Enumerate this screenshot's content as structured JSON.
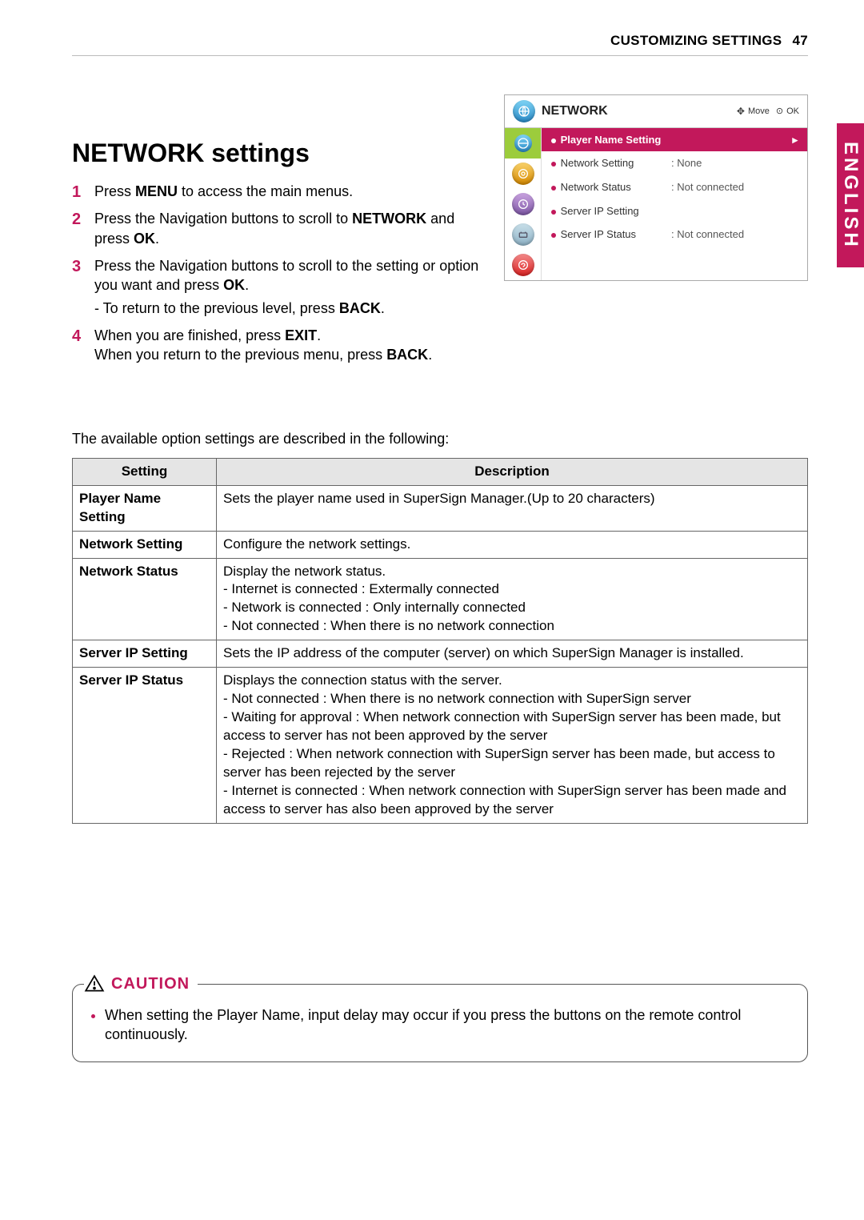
{
  "running_head": {
    "label": "CUSTOMIZING SETTINGS",
    "page": "47"
  },
  "side_tab": "ENGLISH",
  "section_title": "NETWORK settings",
  "steps": [
    {
      "html": "Press <b>MENU</b> to access the main menus."
    },
    {
      "html": "Press the Navigation buttons to scroll to <b>NETWORK</b> and press <b>OK</b>."
    },
    {
      "html": "Press the Navigation buttons to scroll to the setting or option you want and press <b>OK</b>.",
      "sub": "- To return to the previous level, press <b>BACK</b>."
    },
    {
      "html": "When you are finished, press <b>EXIT</b>.<br>When you return to the previous menu, press <b>BACK</b>."
    }
  ],
  "intro_line": "The available option settings are described in the following:",
  "table": {
    "headers": {
      "setting": "Setting",
      "description": "Description"
    },
    "rows": [
      {
        "setting": "Player Name Setting",
        "description": "Sets the player name used in SuperSign Manager.(Up to 20 characters)"
      },
      {
        "setting": "Network Setting",
        "description": "Configure the network settings."
      },
      {
        "setting": "Network Status",
        "description": "Display the network status.\n- Internet is connected : Extermally connected\n- Network is connected : Only internally connected\n- Not connected : When there is no network connection"
      },
      {
        "setting": "Server IP Setting",
        "description": "Sets the IP address of the computer (server) on which SuperSign Manager is installed."
      },
      {
        "setting": "Server IP Status",
        "description": "Displays the connection status with the server.\n- Not connected : When there is no network connection with SuperSign server\n- Waiting for approval : When network connection with SuperSign server has been made, but access to server has not been approved by the server\n- Rejected : When network connection with SuperSign server has been made, but access to server has been rejected by the server\n- Internet is connected : When network connection with SuperSign server has been made and access to server has also been approved by the server"
      }
    ]
  },
  "caution": {
    "label": "CAUTION",
    "items": [
      "When setting the Player Name, input delay may occur if you press the buttons on the remote control continuously."
    ]
  },
  "osd": {
    "title": "NETWORK",
    "hints": {
      "move": "Move",
      "ok": "OK"
    },
    "rows": [
      {
        "label": "Player Name Setting",
        "value": "",
        "highlight": true
      },
      {
        "label": "Network Setting",
        "value": ": None"
      },
      {
        "label": "Network Status",
        "value": ": Not connected"
      },
      {
        "label": "Server IP Setting",
        "value": ""
      },
      {
        "label": "Server IP Status",
        "value": ": Not connected"
      }
    ]
  }
}
